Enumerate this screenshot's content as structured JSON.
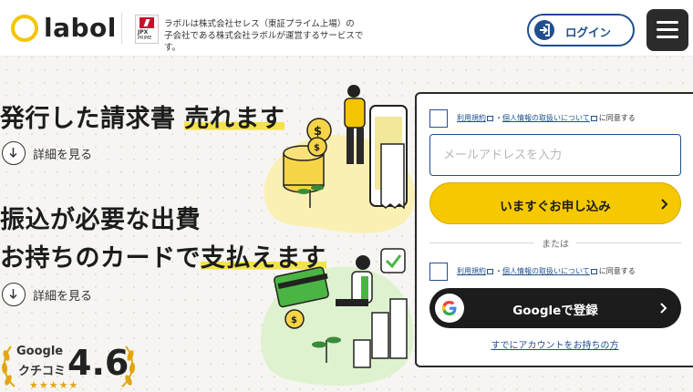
{
  "header": {
    "logo_text": "labol",
    "jpx_line1": "JPX",
    "jpx_line2": "PRIME",
    "notice_line1": "ラボルは株式会社セレス（東証プライム上場）の",
    "notice_line2": "子会社である株式会社ラボルが運営するサービスです。",
    "login_label": "ログイン"
  },
  "hero": {
    "section1": {
      "title_plain": "発行した請求書 ",
      "title_highlight": "売れます",
      "more_label": "詳細を見る"
    },
    "section2": {
      "title_line1": "振込が必要な出費",
      "title_line2_plain": "お持ちのカードで",
      "title_line2_highlight": "支払えます",
      "more_label": "詳細を見る"
    }
  },
  "rating": {
    "source": "Google",
    "label": "クチコミ",
    "score": "4.6",
    "stars": "★★★★★"
  },
  "form": {
    "consent": {
      "terms_link": "利用規約",
      "separator": "・",
      "privacy_link": "個人情報の取扱いについて",
      "agree_text": "に同意する"
    },
    "email_placeholder": "メールアドレスを入力",
    "apply_label": "いますぐお申し込み",
    "or_text": "または",
    "google_label": "Googleで登録",
    "already_link": "すでにアカウントをお持ちの方"
  },
  "colors": {
    "brand_yellow": "#f6c800",
    "brand_blue": "#1f4f8f",
    "dark": "#1c1c1c"
  }
}
